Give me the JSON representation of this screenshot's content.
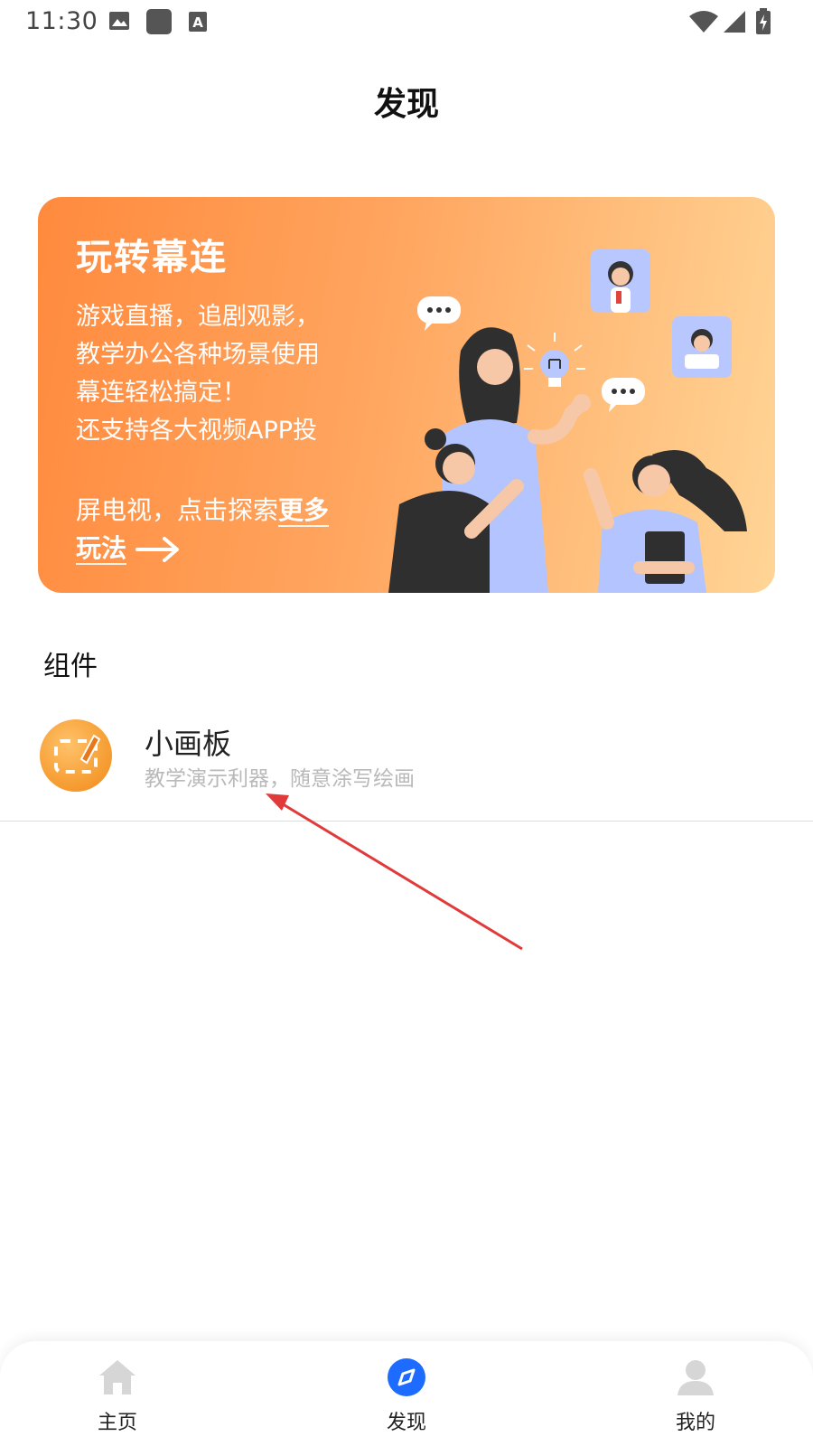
{
  "status_bar": {
    "time": "11:30",
    "icons": [
      "image-icon",
      "app-square-icon",
      "text-a-icon",
      "wifi-icon",
      "signal-icon",
      "battery-charging-icon"
    ]
  },
  "header": {
    "title": "发现"
  },
  "banner": {
    "title": "玩转幕连",
    "desc_lines": [
      "游戏直播，追剧观影，",
      "教学办公各种场景使用",
      "幕连轻松搞定！",
      "还支持各大视频APP投"
    ],
    "link_prefix": "屏电视，点击探索",
    "link_text_1": "更多",
    "link_text_2": "玩法",
    "gradient": [
      "#ff8a3d",
      "#ffd596"
    ]
  },
  "section": {
    "title": "组件"
  },
  "widgets": [
    {
      "name": "小画板",
      "description": "教学演示利器，随意涂写绘画",
      "icon": "drawing-board-icon"
    }
  ],
  "bottom_nav": {
    "items": [
      {
        "label": "主页",
        "icon": "home-icon",
        "active": false
      },
      {
        "label": "发现",
        "icon": "compass-icon",
        "active": true
      },
      {
        "label": "我的",
        "icon": "user-icon",
        "active": false
      }
    ],
    "active_color": "#1e6bff",
    "inactive_color": "#d6d6d6"
  },
  "annotation": {
    "color": "#e03a3a"
  }
}
